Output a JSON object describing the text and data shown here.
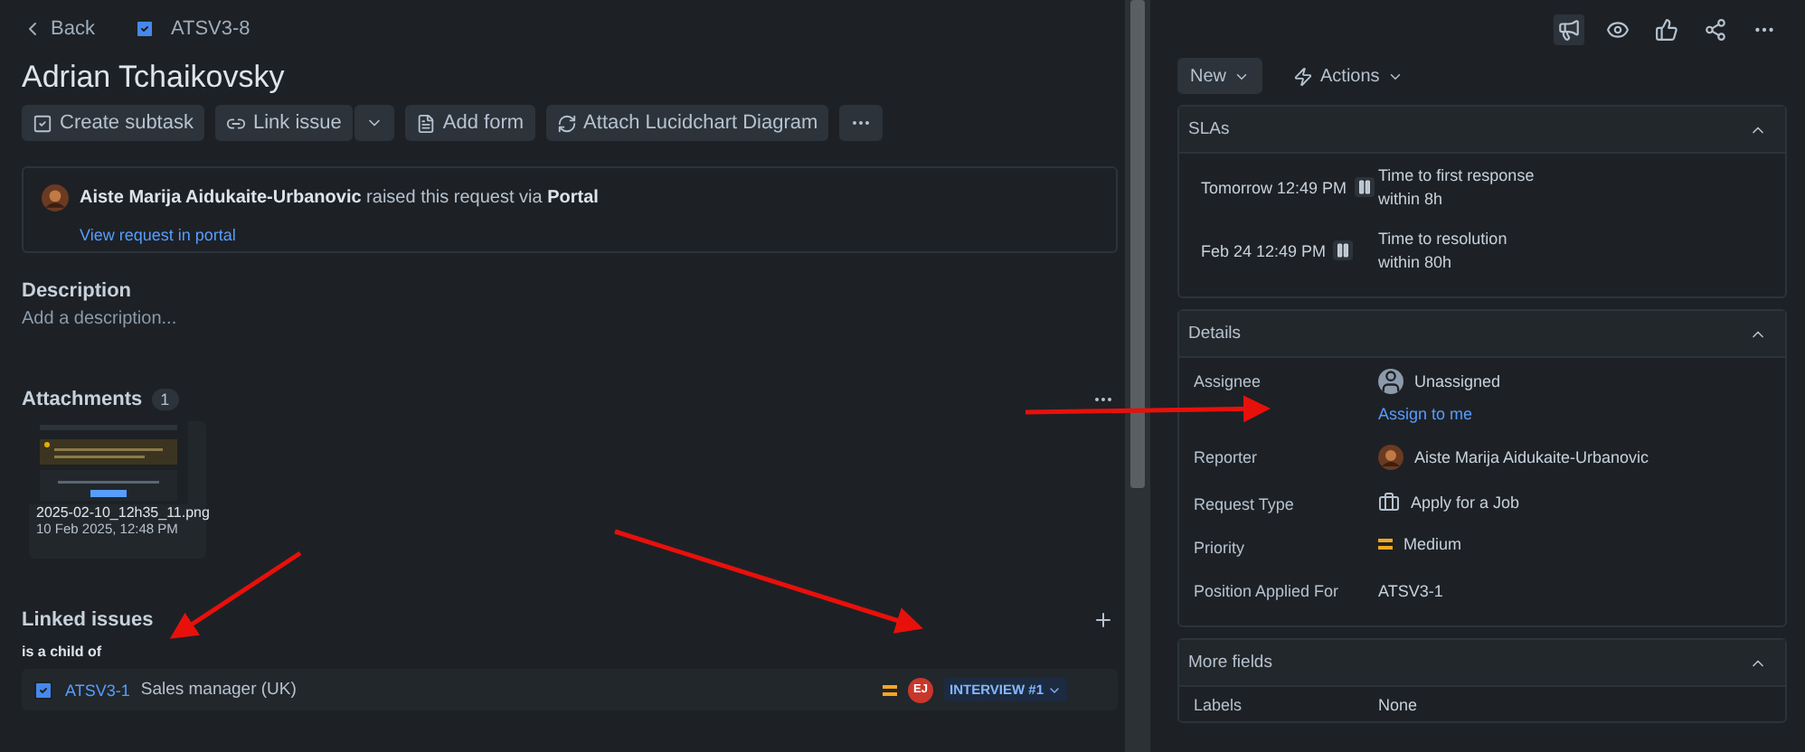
{
  "nav": {
    "back": "Back",
    "issue_key": "ATSV3-8"
  },
  "title": "Adrian Tchaikovsky",
  "toolbar": [
    {
      "kind": "button",
      "label": "Create subtask"
    },
    {
      "kind": "split",
      "label": "Link issue"
    },
    {
      "kind": "button",
      "label": "Add form"
    },
    {
      "kind": "button",
      "label": "Attach Lucidchart Diagram"
    },
    {
      "kind": "more"
    }
  ],
  "request": {
    "text": "**Aiste Marija Aidukaite-Urbanovic** raised this request via **Portal**",
    "link": "View request in portal"
  },
  "description": {
    "heading": "Description",
    "placeholder": "Add a description..."
  },
  "attachments": {
    "heading": "Attachments",
    "count": "1",
    "files": [
      {
        "kind": "picture",
        "name": "2025-02-10_12h35_11.png",
        "date": "10 Feb 2025, 12:48 PM"
      }
    ]
  },
  "linked_issues": {
    "heading": "Linked issues",
    "relation": "is a child of",
    "items": [
      {
        "key": "ATSV3-1",
        "summary": "Sales manager (UK)",
        "avatar": "EJ",
        "status": "INTERVIEW #1"
      }
    ]
  },
  "status_button": "New",
  "actions_button": "Actions",
  "sla": {
    "heading": "SLAs",
    "expanded": true,
    "items": [
      {
        "due": "Tomorrow 12:49 PM",
        "goal": "Time to first response",
        "within": "within 8h"
      },
      {
        "due": "Feb 24 12:49 PM",
        "goal": "Time to resolution",
        "within": "within 80h"
      }
    ]
  },
  "details": {
    "heading": "Details",
    "expanded": true,
    "fields": [
      {
        "kind": "assignee",
        "label": "Assignee",
        "value": "Unassigned",
        "link": "Assign to me"
      },
      {
        "kind": "user",
        "label": "Reporter",
        "value": "Aiste Marija Aidukaite-Urbanovic"
      },
      {
        "kind": "request",
        "label": "Request Type",
        "value": "Apply for a Job"
      },
      {
        "kind": "priority",
        "label": "Priority",
        "value": "Medium"
      },
      {
        "kind": "text",
        "label": "Position Applied For",
        "value": "ATSV3-1"
      }
    ]
  },
  "more_fields": {
    "heading": "More fields",
    "expanded": true,
    "fields": [
      {
        "kind": "text",
        "label": "Labels",
        "value": "None"
      }
    ]
  }
}
